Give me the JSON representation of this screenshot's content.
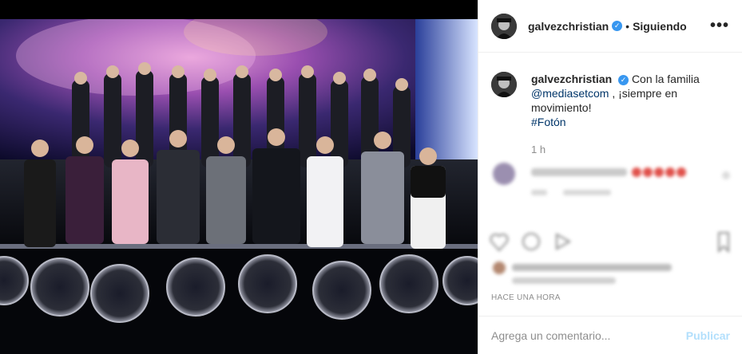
{
  "post": {
    "username": "galvezchristian",
    "follow_status": "Siguiendo",
    "separator": "•",
    "more": "•••",
    "verified_glyph": "✓"
  },
  "caption": {
    "username": "galvezchristian",
    "text_pre": "Con la familia",
    "mention": "@mediasetcom",
    "text_post": ", ¡siempre en movimiento!",
    "hashtag": "#Fotón",
    "age": "1 h"
  },
  "timestamp": "HACE UNA HORA",
  "comment_box": {
    "placeholder": "Agrega un comentario...",
    "publish_label": "Publicar"
  },
  "colors": {
    "verified": "#3897f0",
    "link": "#003569",
    "publish_disabled": "#b2dffc"
  }
}
